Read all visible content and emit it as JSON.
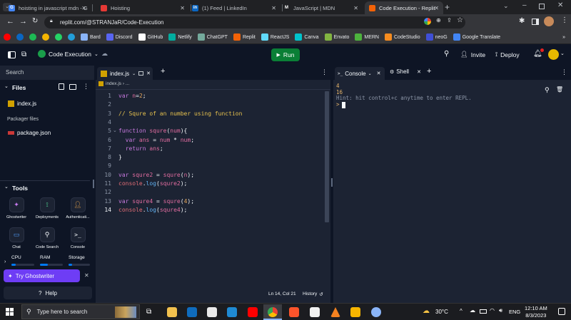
{
  "browser": {
    "tabs": [
      {
        "title": "hoisting in javascript mdn - G",
        "favicon_color": "#4285f4",
        "favicon_letter": "G",
        "active": false
      },
      {
        "title": "Hoisting",
        "favicon_color": "#e53935",
        "favicon_letter": "",
        "active": false
      },
      {
        "title": "(1) Feed | LinkedIn",
        "favicon_color": "#0a66c2",
        "favicon_letter": "in",
        "active": false
      },
      {
        "title": "JavaScript | MDN",
        "favicon_color": "#202124",
        "favicon_letter": "M",
        "active": false
      },
      {
        "title": "Code Execution - Replit",
        "favicon_color": "#f26207",
        "favicon_letter": "",
        "active": true
      }
    ],
    "url": "replit.com/@STRANJaR/Code-Execution",
    "bookmarks": [
      {
        "label": "",
        "color": "#ff0000"
      },
      {
        "label": "",
        "color": "#0a66c2"
      },
      {
        "label": "",
        "color": "#1db954"
      },
      {
        "label": "",
        "color": "#f4b400"
      },
      {
        "label": "",
        "color": "#25d366"
      },
      {
        "label": "",
        "color": "#229ed9"
      },
      {
        "label": "Bard",
        "color": "#8ab4f8"
      },
      {
        "label": "Discord",
        "color": "#5865f2"
      },
      {
        "label": "GitHub",
        "color": "#ffffff"
      },
      {
        "label": "Netlify",
        "color": "#00ad9f"
      },
      {
        "label": "ChatGPT",
        "color": "#74aa9c"
      },
      {
        "label": "Replit",
        "color": "#f26207"
      },
      {
        "label": "ReactJS",
        "color": "#61dafb"
      },
      {
        "label": "Canva",
        "color": "#00c4cc"
      },
      {
        "label": "Envato",
        "color": "#82b541"
      },
      {
        "label": "MERN",
        "color": "#4db33d"
      },
      {
        "label": "CodeStudio",
        "color": "#f78c1f"
      },
      {
        "label": "neoG",
        "color": "#3f4fd6"
      },
      {
        "label": "Google Translate",
        "color": "#4285f4"
      }
    ],
    "bookmarks_more": "»"
  },
  "replit": {
    "repl_name": "Code Execution",
    "run_label": "Run",
    "invite_label": "Invite",
    "deploy_label": "Deploy",
    "sidebar": {
      "search_placeholder": "Search",
      "files_title": "Files",
      "files": [
        "index.js"
      ],
      "packager_title": "Packager files",
      "packager_files": [
        "package.json"
      ],
      "tools_title": "Tools",
      "tools": [
        "Ghostwriter",
        "Deployments",
        "Authenticati...",
        "Chat",
        "Code Search",
        "Console"
      ],
      "resources": [
        "CPU",
        "RAM",
        "Storage"
      ],
      "try_ghostwriter": "Try Ghostwriter",
      "help": "Help"
    },
    "editor": {
      "tab_label": "index.js",
      "breadcrumb": "index.js › ...",
      "lines": [
        "var n=2;",
        "",
        "// Squre of an number using function",
        "",
        "function squre(num){",
        "  var ans = num * num;",
        "  return ans;",
        "}",
        "",
        "var squre2 = squre(n);",
        "console.log(squre2);",
        "",
        "var squre4 = squre(4);",
        "console.log(squre4);"
      ],
      "status_position": "Ln 14, Col 21",
      "history_label": "History"
    },
    "console": {
      "tab_console": "Console",
      "tab_shell": "Shell",
      "output": [
        "4",
        "16"
      ],
      "hint": "Hint: hit control+c anytime to enter REPL.",
      "prompt": ">"
    }
  },
  "taskbar": {
    "search_placeholder": "Type here to search",
    "weather": "30°C",
    "language": "ENG",
    "time": "12:10 AM",
    "date": "8/3/2023"
  }
}
